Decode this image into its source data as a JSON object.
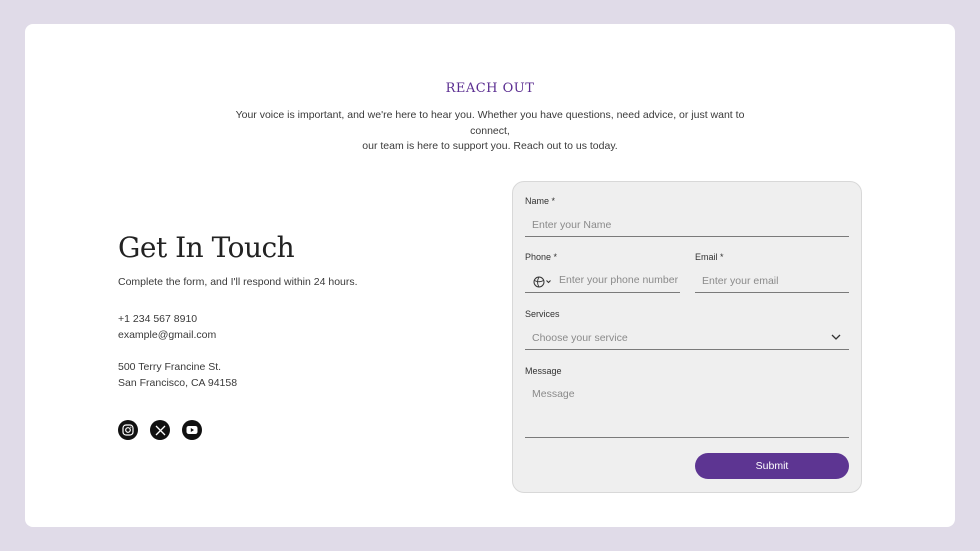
{
  "header": {
    "title": "REACH OUT",
    "intro_line1": "Your voice is important, and we're here to hear you. Whether you have questions, need advice, or just want to connect,",
    "intro_line2": "our team is here to support you. Reach out to us today."
  },
  "contact": {
    "title": "Get In Touch",
    "subtitle": "Complete the form, and I'll respond within 24 hours.",
    "phone": "+1 234 567 8910",
    "email": "example@gmail.com",
    "address_line1": "500 Terry Francine St.",
    "address_line2": "San Francisco, CA 94158",
    "socials": [
      "instagram-icon",
      "x-icon",
      "youtube-icon"
    ]
  },
  "form": {
    "name_label": "Name *",
    "name_placeholder": "Enter your Name",
    "phone_label": "Phone *",
    "phone_placeholder": "Enter your phone number",
    "email_label": "Email *",
    "email_placeholder": "Enter your email",
    "services_label": "Services",
    "services_placeholder": "Choose your service",
    "message_label": "Message",
    "message_placeholder": "Message",
    "submit_label": "Submit"
  },
  "colors": {
    "page_background": "#e0dbe8",
    "accent": "#5d3592",
    "heading": "#5b2e91"
  }
}
